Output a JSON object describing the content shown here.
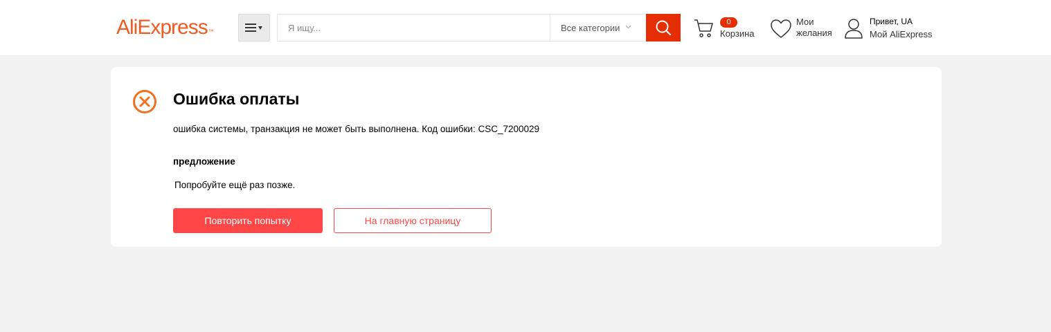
{
  "header": {
    "logo_text": "AliExpress",
    "logo_tm": "™",
    "search": {
      "placeholder": "Я ищу...",
      "value": ""
    },
    "category_select": "Все категории",
    "cart": {
      "count": "0",
      "label": "Корзина"
    },
    "wishlist": {
      "line1": "Мои",
      "line2": "желания"
    },
    "account": {
      "greeting": "Привет, UA",
      "label": "Мой AliExpress"
    }
  },
  "error_card": {
    "title": "Ошибка оплаты",
    "message": "ошибка системы, транзакция не может быть выполнена. Код ошибки: CSC_7200029",
    "suggestion_heading": "предложение",
    "suggestion_text": "Попробуйте ещё раз позже.",
    "retry_button": "Повторить попытку",
    "home_button": "На главную страницу"
  },
  "colors": {
    "brand_orange": "#f15a22",
    "search_red": "#e62e04",
    "action_red": "#ff4747",
    "error_icon": "#f26f1f"
  },
  "icons": [
    "menu-icon",
    "search-icon",
    "cart-icon",
    "heart-icon",
    "user-icon",
    "error-x-icon",
    "chevron-down-icon"
  ]
}
